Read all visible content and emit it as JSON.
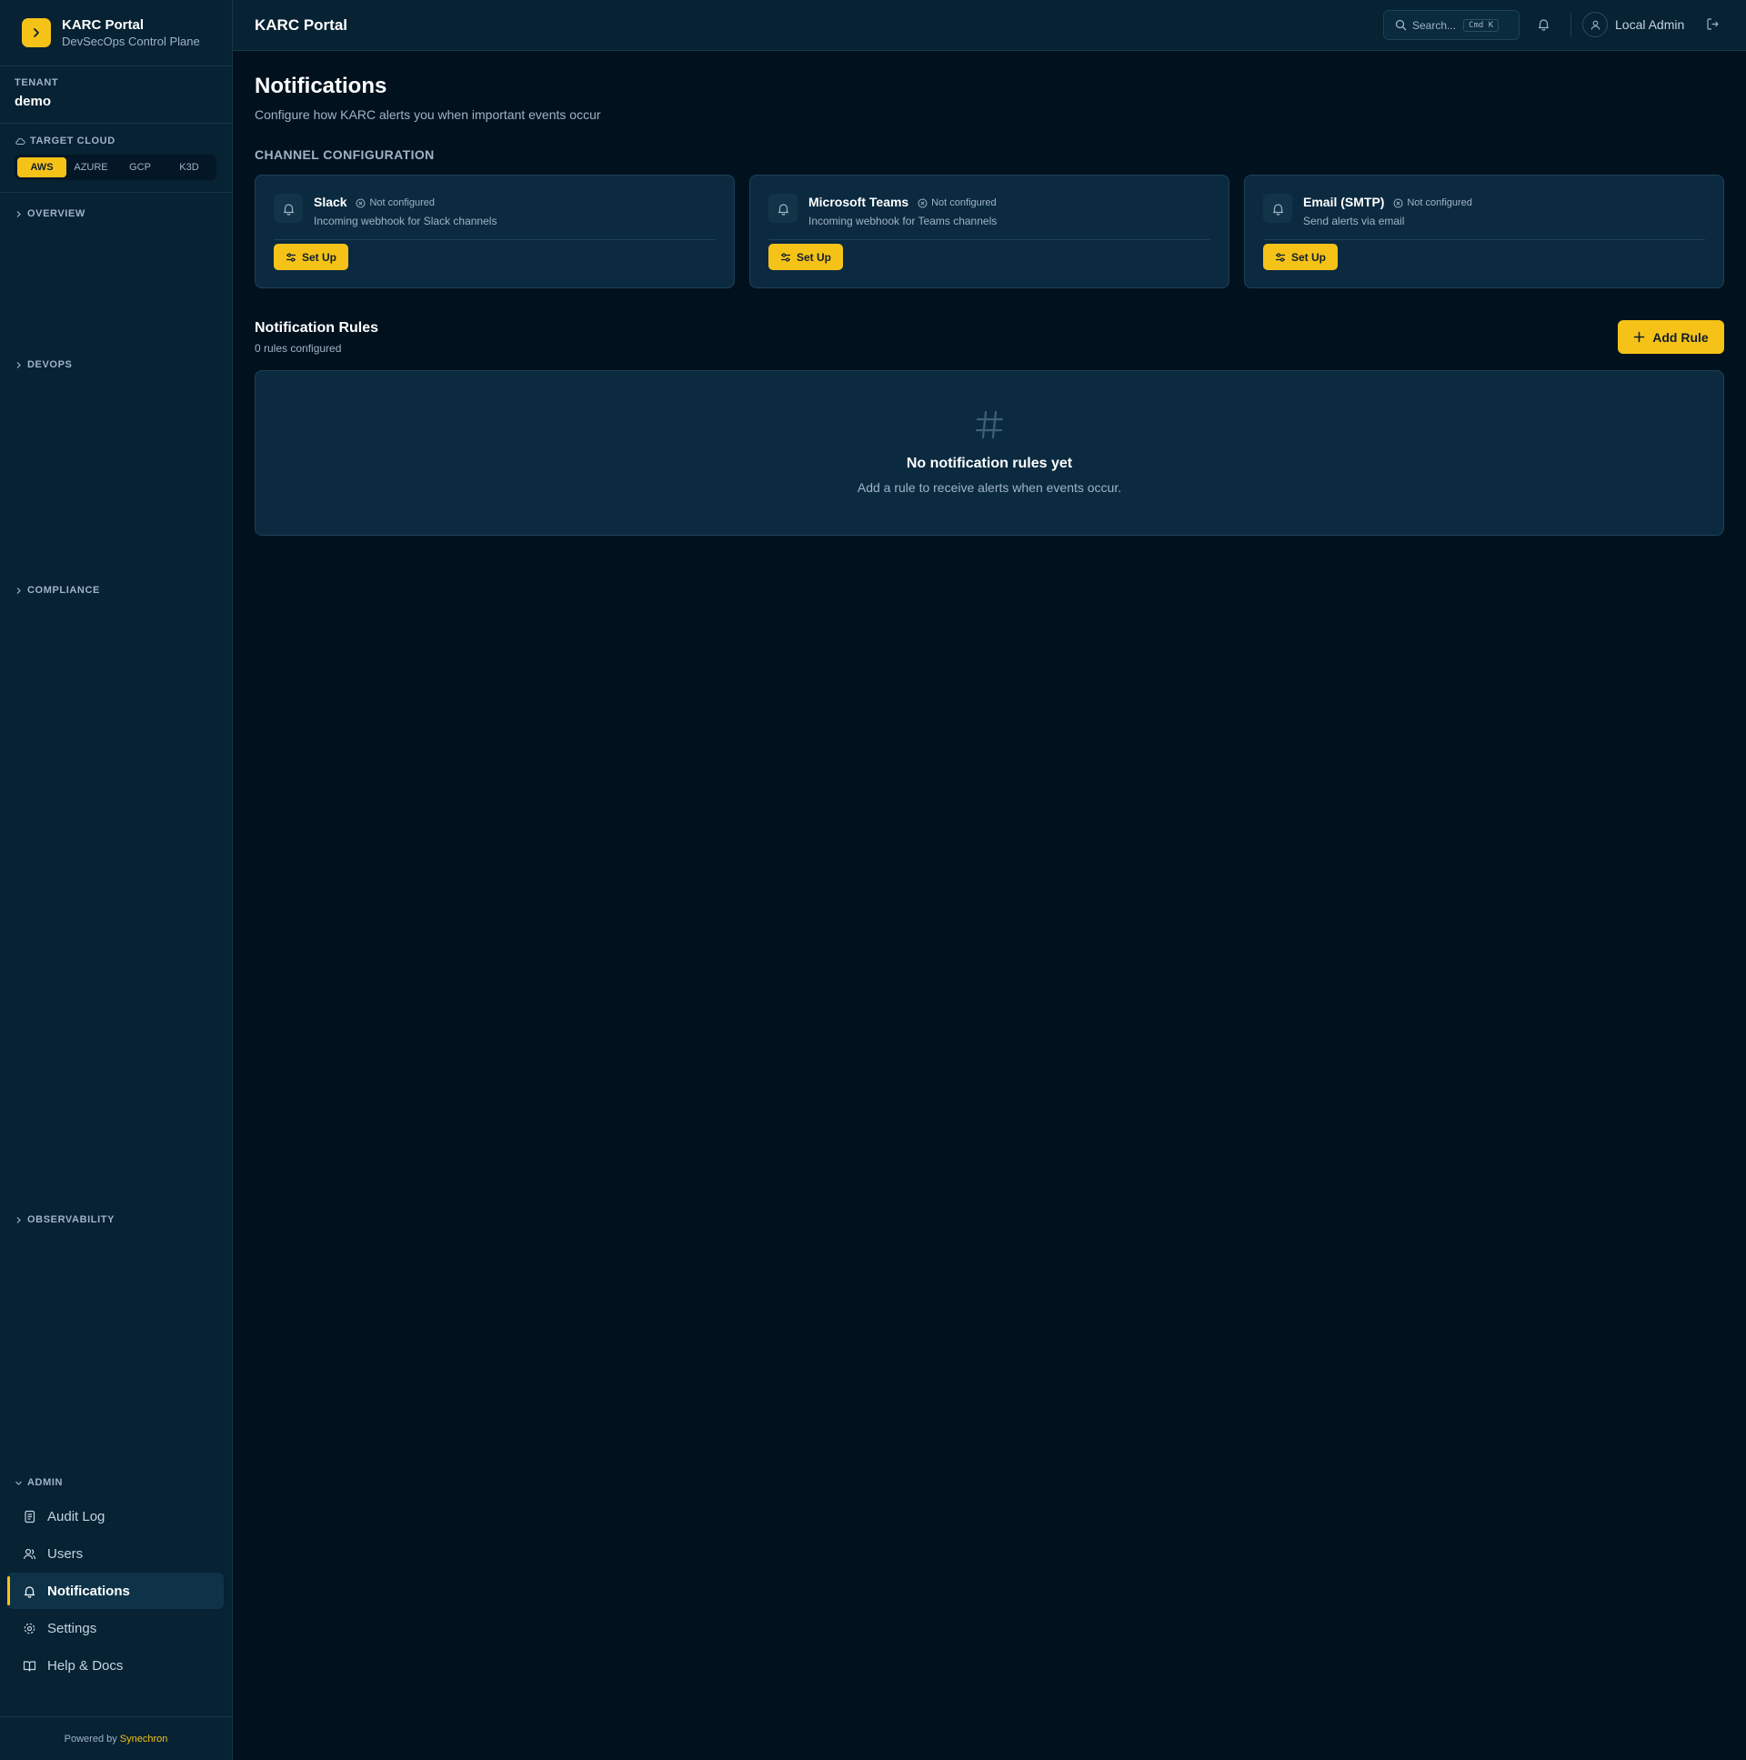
{
  "brand": {
    "title": "KARC Portal",
    "subtitle": "DevSecOps Control Plane"
  },
  "tenant": {
    "label": "TENANT",
    "value": "demo"
  },
  "cloud": {
    "label": "TARGET CLOUD",
    "options": [
      "AWS",
      "AZURE",
      "GCP",
      "K3D"
    ],
    "selected": "AWS"
  },
  "nav": {
    "groups": {
      "overview": "OVERVIEW",
      "devops": "DEVOPS",
      "compliance": "COMPLIANCE",
      "observability": "OBSERVABILITY",
      "admin": "ADMIN"
    },
    "admin_items": [
      "Audit Log",
      "Users",
      "Notifications",
      "Settings",
      "Help & Docs"
    ],
    "active": "Notifications"
  },
  "footer": {
    "powered_by": "Powered by",
    "brand": "Synechron"
  },
  "topbar": {
    "title": "KARC Portal",
    "search_placeholder": "Search...",
    "search_shortcut": "Cmd K",
    "user": "Local Admin"
  },
  "page": {
    "title": "Notifications",
    "subtitle": "Configure how KARC alerts you when important events occur",
    "channel_section": "CHANNEL CONFIGURATION",
    "channels": [
      {
        "name": "Slack",
        "status": "Not configured",
        "description": "Incoming webhook for Slack channels",
        "button": "Set Up"
      },
      {
        "name": "Microsoft Teams",
        "status": "Not configured",
        "description": "Incoming webhook for Teams channels",
        "button": "Set Up"
      },
      {
        "name": "Email (SMTP)",
        "status": "Not configured",
        "description": "Send alerts via email",
        "button": "Set Up"
      }
    ],
    "rules": {
      "title": "Notification Rules",
      "count_text": "0 rules configured",
      "add_button": "Add Rule",
      "empty_title": "No notification rules yet",
      "empty_subtitle": "Add a rule to receive alerts when events occur."
    }
  },
  "colors": {
    "accent": "#f5c218",
    "sidebar_bg": "#062233",
    "page_bg": "#02111e",
    "card_bg": "#0b2a40"
  }
}
